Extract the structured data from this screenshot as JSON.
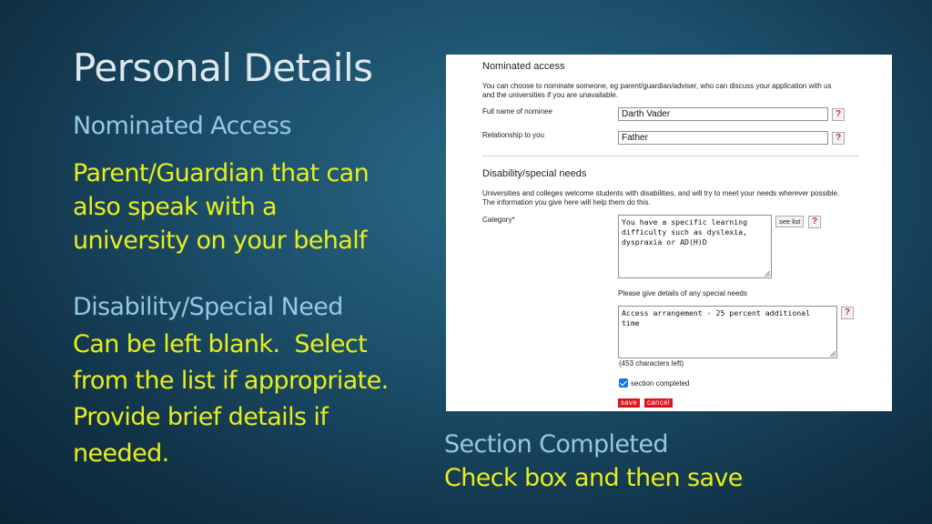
{
  "slide": {
    "title": "Personal Details",
    "nominated_heading": "Nominated Access",
    "nominated_text_lines": [
      "Parent/Guardian that can",
      "also speak with a",
      "university on your behalf"
    ],
    "disability_heading": "Disability/Special Need",
    "disability_text_lines": [
      "Can be left blank.  Select",
      "from the list if appropriate.",
      "Provide brief details if",
      "needed."
    ],
    "completed_heading": "Section Completed",
    "completed_text": "Check box and then save"
  },
  "form": {
    "nominated": {
      "heading": "Nominated access",
      "intro_lines": [
        "You can choose to nominate someone, eg parent/guardian/adviser, who can discuss your application with us",
        "and the universities if you are unavailable."
      ],
      "nominee_label": "Full name of nominee",
      "nominee_value": "Darth Vader",
      "relationship_label": "Relationship to you",
      "relationship_value": "Father",
      "help_label": "?"
    },
    "disability": {
      "heading": "Disability/special needs",
      "intro_lines": [
        "Universities and colleges welcome students with disabilities, and will try to meet your needs wherever possible.",
        "The information you give here will help them do this."
      ],
      "category_label": "Category*",
      "category_lines": [
        "You have a specific learning",
        "difficulty such as dyslexia,",
        "dyspraxia or AD(H)D"
      ],
      "see_list_label": "see list",
      "details_label": "Please give details of any special needs",
      "details_lines": [
        "Access arrangement - 25 percent additional",
        "time"
      ],
      "chars_left": "(453 characters left)",
      "section_completed_label": "section completed",
      "section_completed_checked": true
    },
    "actions": {
      "save_label": "save",
      "cancel_label": "cancel"
    },
    "colors": {
      "button_red": "#e0121c",
      "help_red": "#c0392b",
      "checkbox_blue": "#1a73e8"
    }
  }
}
